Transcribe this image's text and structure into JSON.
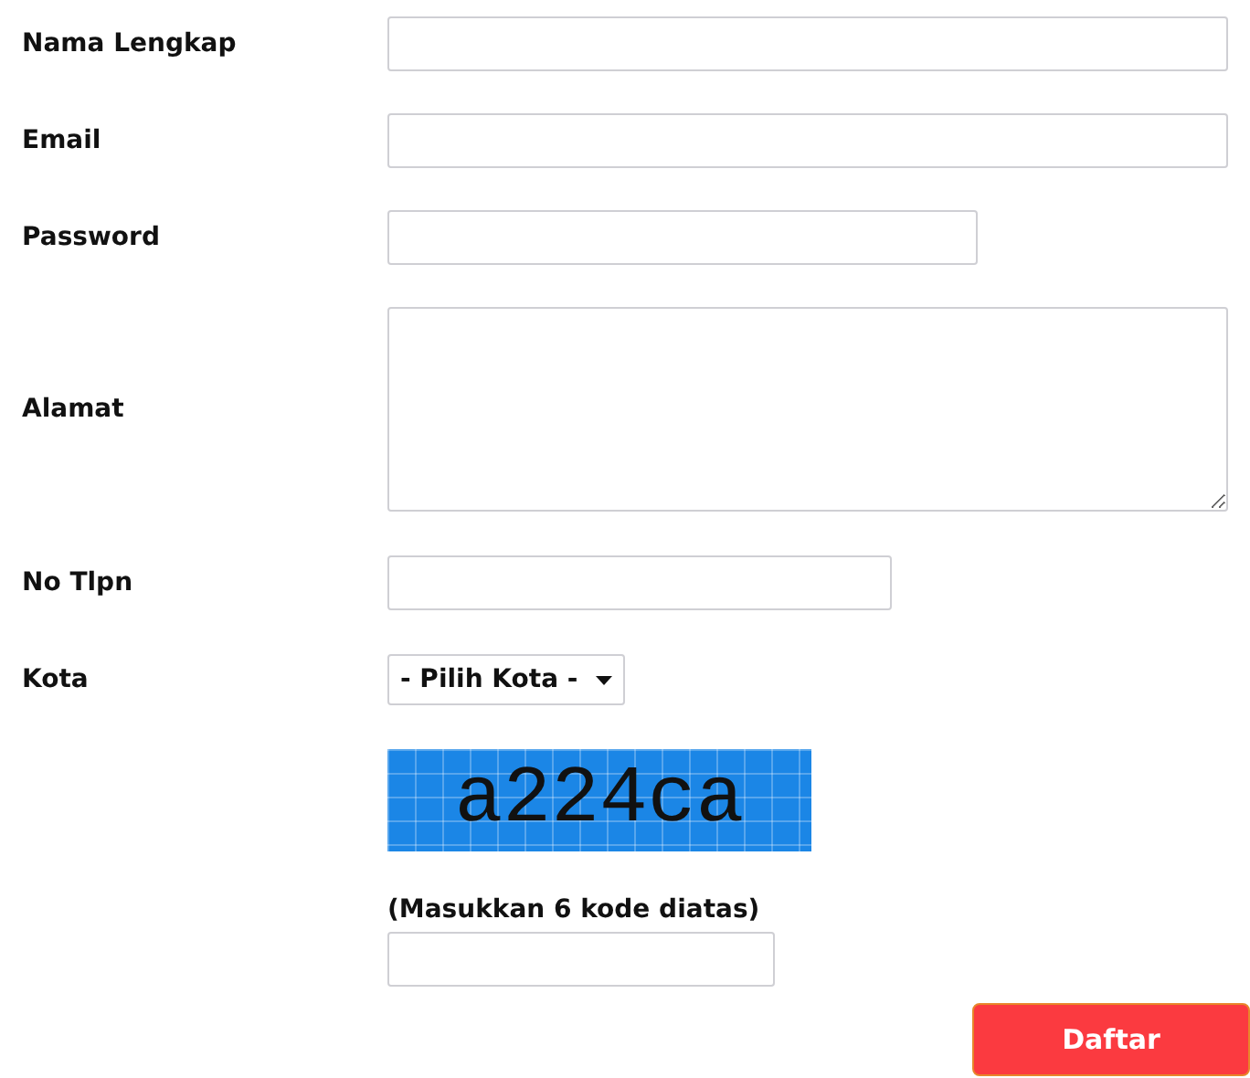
{
  "fields": [
    {
      "label": "Nama Lengkap",
      "kind": "text"
    },
    {
      "label": "Email",
      "kind": "text"
    },
    {
      "label": "Password",
      "kind": "password"
    },
    {
      "label": "Alamat",
      "kind": "textarea"
    },
    {
      "label": "No Tlpn",
      "kind": "text"
    },
    {
      "label": "Kota",
      "kind": "select",
      "value": "- Pilih Kota -"
    }
  ],
  "captcha": {
    "code": "a224ca",
    "hint": "(Masukkan 6 kode diatas)"
  },
  "submit": "Daftar"
}
